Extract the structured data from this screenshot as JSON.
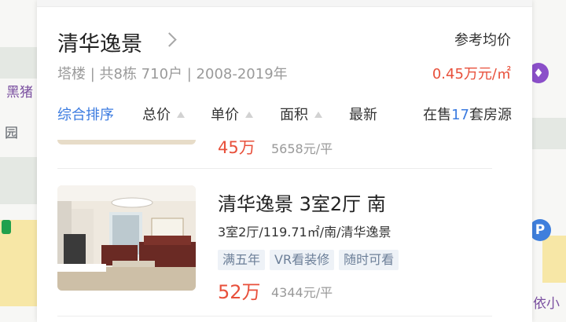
{
  "map": {
    "labels": [
      "黑猪",
      "园",
      "依小"
    ],
    "pin_icon": "map-pin-icon",
    "parking_label": "P"
  },
  "community": {
    "name": "清华逸景",
    "meta": "塔楼 | 共8栋 710户 | 2008-2019年",
    "ref_label": "参考均价",
    "avg_price": "0.45万元/㎡"
  },
  "sort": {
    "items": [
      "综合排序",
      "总价",
      "单价",
      "面积",
      "最新"
    ],
    "active_index": 0,
    "count_prefix": "在售",
    "count": "17",
    "count_suffix": "套房源"
  },
  "listings": [
    {
      "price": "45万",
      "unit_price": "5658元/平"
    },
    {
      "title": "清华逸景 3室2厅 南",
      "detail": "3室2厅/119.71㎡/南/清华逸景",
      "tags": [
        "满五年",
        "VR看装修",
        "随时可看"
      ],
      "price": "52万",
      "unit_price": "4344元/平"
    }
  ],
  "colors": {
    "accent": "#3b7be0",
    "price": "#e8503b",
    "tag_bg": "#eef2f7",
    "tag_text": "#6c7f98"
  }
}
